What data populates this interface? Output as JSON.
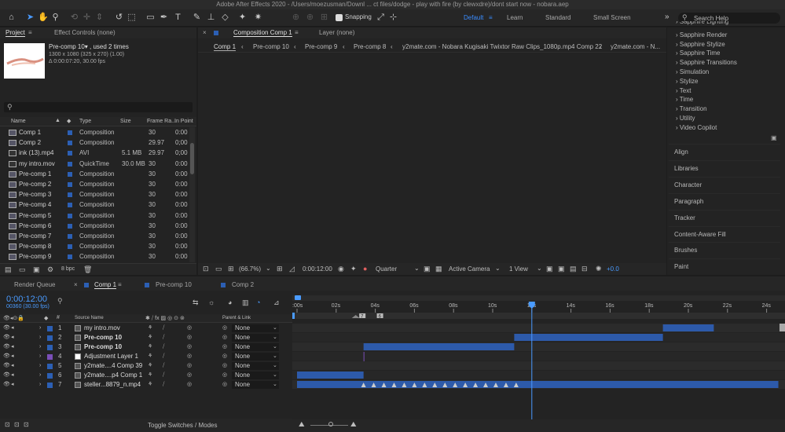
{
  "app": {
    "title": "Adobe After Effects 2020 - /Users/moezusman/Downl ... ct files/dodge - play with fire (by clewxdre)/dont start now - nobara.aep"
  },
  "toolbar": {
    "snapping_label": "Snapping",
    "workspaces": [
      "Default",
      "Learn",
      "Standard",
      "Small Screen"
    ],
    "search_placeholder": "Search Help"
  },
  "project": {
    "tab_label": "Project",
    "effect_controls_label": "Effect Controls (none)",
    "preview_name": "Pre-comp 10▾ , used 2 times",
    "preview_dims": "1300 x 1080  (325 x 270) (1.00)",
    "preview_duration": "Δ 0:00:07:20, 30.00 fps",
    "search_placeholder": "",
    "columns": [
      "Name",
      "Type",
      "Size",
      "Frame Ra...",
      "In Point"
    ],
    "items": [
      {
        "name": "Comp 1",
        "type": "Composition",
        "size": "",
        "fps": "30",
        "in": "0:00"
      },
      {
        "name": "Comp 2",
        "type": "Composition",
        "size": "",
        "fps": "29.97",
        "in": "0;00"
      },
      {
        "name": "ink (13).mp4",
        "type": "AVI",
        "size": "5.1 MB",
        "fps": "29.97",
        "in": "0;00"
      },
      {
        "name": "my intro.mov",
        "type": "QuickTime",
        "size": "30.0 MB",
        "fps": "30",
        "in": "0:00"
      },
      {
        "name": "Pre-comp 1",
        "type": "Composition",
        "size": "",
        "fps": "30",
        "in": "0:00"
      },
      {
        "name": "Pre-comp 2",
        "type": "Composition",
        "size": "",
        "fps": "30",
        "in": "0:00"
      },
      {
        "name": "Pre-comp 3",
        "type": "Composition",
        "size": "",
        "fps": "30",
        "in": "0:00"
      },
      {
        "name": "Pre-comp 4",
        "type": "Composition",
        "size": "",
        "fps": "30",
        "in": "0:00"
      },
      {
        "name": "Pre-comp 5",
        "type": "Composition",
        "size": "",
        "fps": "30",
        "in": "0:00"
      },
      {
        "name": "Pre-comp 6",
        "type": "Composition",
        "size": "",
        "fps": "30",
        "in": "0:00"
      },
      {
        "name": "Pre-comp 7",
        "type": "Composition",
        "size": "",
        "fps": "30",
        "in": "0:00"
      },
      {
        "name": "Pre-comp 8",
        "type": "Composition",
        "size": "",
        "fps": "30",
        "in": "0:00"
      },
      {
        "name": "Pre-comp 9",
        "type": "Composition",
        "size": "",
        "fps": "30",
        "in": "0:00"
      }
    ],
    "bpc_label": "8 bpc"
  },
  "composition": {
    "tab_label": "Composition Comp 1",
    "layer_label": "Layer (none)",
    "nav_items": [
      "Comp 1",
      "Pre-comp 10",
      "Pre-comp 9",
      "Pre-comp 8",
      "y2mate.com - Nobara Kugisaki Twixtor  Raw Clips_1080p.mp4 Comp 22",
      "y2mate.com - N..."
    ],
    "footer": {
      "zoom": "(66.7%)",
      "timecode": "0:00:12:00",
      "resolution": "Quarter",
      "camera": "Active Camera",
      "view": "1 View",
      "exposure": "+0.0"
    }
  },
  "effects_list": [
    "Sapphire Lighting",
    "Sapphire Render",
    "Sapphire Stylize",
    "Sapphire Time",
    "Sapphire Transitions",
    "Simulation",
    "Stylize",
    "Text",
    "Time",
    "Transition",
    "Utility",
    "Video Copilot"
  ],
  "right_panels": [
    "Align",
    "Libraries",
    "Character",
    "Paragraph",
    "Tracker",
    "Content-Aware Fill",
    "Brushes",
    "Paint"
  ],
  "timeline": {
    "tabs": [
      "Render Queue",
      "Comp 1",
      "Pre-comp 10",
      "Comp 2"
    ],
    "timecode": "0:00:12:00",
    "frames": "00360 (30.00 fps)",
    "headers": {
      "source": "Source Name",
      "parent": "Parent & Link"
    },
    "ruler_labels": [
      ":00s",
      "02s",
      "04s",
      "06s",
      "08s",
      "10s",
      "12s",
      "14s",
      "16s",
      "18s",
      "20s",
      "22s",
      "24s"
    ],
    "playhead_seconds": 12,
    "markers": [
      "7",
      "6"
    ],
    "layers": [
      {
        "num": "1",
        "name": "my intro.mov",
        "parent": "None",
        "start": 18.7,
        "end": 21.3,
        "color": "#2c5fb4"
      },
      {
        "num": "2",
        "name": "Pre-comp 10",
        "parent": "None",
        "start": 11.1,
        "end": 18.7,
        "color": "#2c5fb4"
      },
      {
        "num": "3",
        "name": "Pre-comp 10",
        "parent": "None",
        "start": 3.4,
        "end": 11.1,
        "color": "#2c5fb4"
      },
      {
        "num": "4",
        "name": "Adjustment Layer 1",
        "parent": "None",
        "start": 0,
        "end": 0,
        "color": "#7a4fb8"
      },
      {
        "num": "5",
        "name": "y2mate....4 Comp 39",
        "parent": "None",
        "start": 0,
        "end": 0,
        "color": "#2c5fb4"
      },
      {
        "num": "6",
        "name": "y2mate....p4 Comp 1",
        "parent": "None",
        "start": 0,
        "end": 3.4,
        "color": "#2c5fb4"
      },
      {
        "num": "7",
        "name": "steller...8879_n.mp4",
        "parent": "None",
        "start": 0,
        "end": 24.6,
        "color": "#2c5fb4"
      }
    ],
    "toggle_label": "Toggle Switches / Modes"
  }
}
